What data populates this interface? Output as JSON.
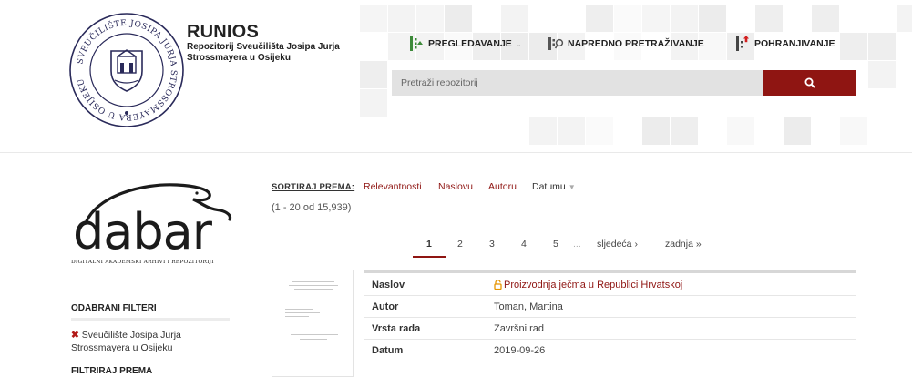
{
  "header": {
    "brand_title": "RUNIOS",
    "brand_subtitle": "Repozitorij Sveučilišta Josipa Jurja Strossmayera u Osijeku",
    "seal_text": "SVEUČILIŠTE JOSIPA JURJA STROSSMAYERA U OSIJEKU",
    "nav": {
      "browse_label": "PREGLEDAVANJE",
      "advanced_label": "NAPREDNO PRETRAŽIVANJE",
      "deposit_label": "POHRANJIVANJE"
    },
    "search": {
      "placeholder": "Pretraži repozitorij",
      "value": ""
    }
  },
  "sidebar": {
    "dabar_logo_text": "dabar",
    "dabar_tagline": "DIGITALNI AKADEMSKI ARHIVI I REPOZITORIJI",
    "selected_filters_heading": "ODABRANI FILTERI",
    "selected_filters": [
      "Sveučilište Josipa Jurja Strossmayera u Osijeku"
    ],
    "filter_by_heading": "FILTRIRAJ PREMA"
  },
  "sort": {
    "label": "SORTIRAJ PREMA:",
    "options": [
      "Relevantnosti",
      "Naslovu",
      "Autoru",
      "Datumu"
    ]
  },
  "results": {
    "count_text": "(1 - 20 od 15,939)",
    "pagination": {
      "pages": [
        "1",
        "2",
        "3",
        "4",
        "5"
      ],
      "current": "1",
      "ellipsis": "...",
      "next_label": "sljedeća ›",
      "last_label": "zadnja »"
    },
    "items": [
      {
        "fields": [
          {
            "key": "Naslov",
            "value": "Proizvodnja ječma u Republici Hrvatskoj"
          },
          {
            "key": "Autor",
            "value": "Toman, Martina"
          },
          {
            "key": "Vrsta rada",
            "value": "Završni rad"
          },
          {
            "key": "Datum",
            "value": "2019-09-26"
          }
        ]
      }
    ]
  },
  "colors": {
    "accent": "#8f1512",
    "search_bg": "#e2e2e2",
    "brand_green": "#3d8a3a",
    "deposit_red": "#d21f1f"
  }
}
